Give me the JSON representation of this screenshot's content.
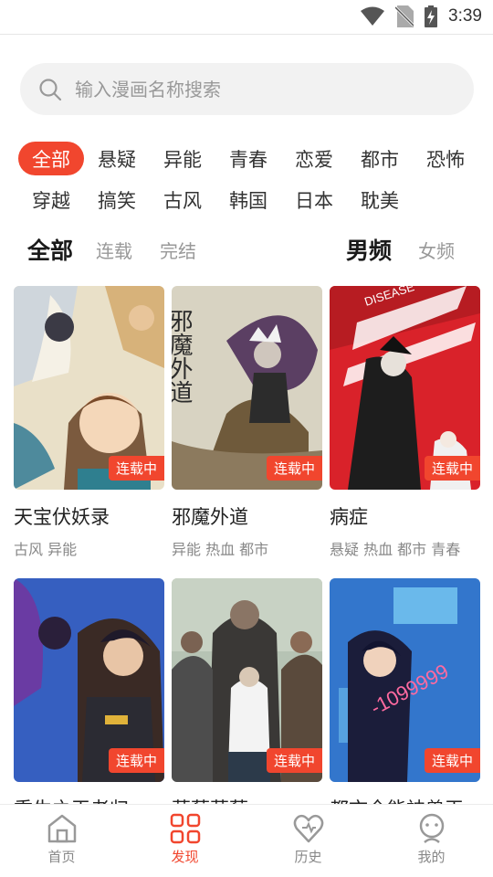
{
  "status": {
    "time": "3:39"
  },
  "search": {
    "placeholder": "输入漫画名称搜索"
  },
  "genres": [
    {
      "label": "全部",
      "active": true
    },
    {
      "label": "悬疑"
    },
    {
      "label": "异能"
    },
    {
      "label": "青春"
    },
    {
      "label": "恋爱"
    },
    {
      "label": "都市"
    },
    {
      "label": "恐怖"
    },
    {
      "label": "穿越"
    },
    {
      "label": "搞笑"
    },
    {
      "label": "古风"
    },
    {
      "label": "韩国"
    },
    {
      "label": "日本"
    },
    {
      "label": "耽美"
    }
  ],
  "status_filters": [
    "全部",
    "连载",
    "完结"
  ],
  "gender_filters": [
    "男频",
    "女频"
  ],
  "comics": [
    {
      "title": "天宝伏妖录",
      "tags": "古风 异能",
      "badge": "连载中"
    },
    {
      "title": "邪魔外道",
      "tags": "异能 热血 都市",
      "badge": "连载中",
      "cover_text": "邪魔外道"
    },
    {
      "title": "病症",
      "tags": "悬疑 热血 都市 青春",
      "badge": "连载中",
      "cover_text": "DISEASE"
    },
    {
      "title": "重生之王者归",
      "tags": "",
      "badge": "连载中"
    },
    {
      "title": "草莓草莓",
      "tags": "",
      "badge": "连载中"
    },
    {
      "title": "都市全能神兽王",
      "tags": "",
      "badge": "连载中",
      "cover_text": "-1099999"
    }
  ],
  "tabbar": [
    {
      "label": "首页",
      "icon": "home-icon"
    },
    {
      "label": "发现",
      "icon": "discover-icon",
      "active": true
    },
    {
      "label": "历史",
      "icon": "history-heart-icon"
    },
    {
      "label": "我的",
      "icon": "profile-icon"
    }
  ],
  "colors": {
    "accent": "#f1462e",
    "search_bg": "#f2f2f2"
  }
}
